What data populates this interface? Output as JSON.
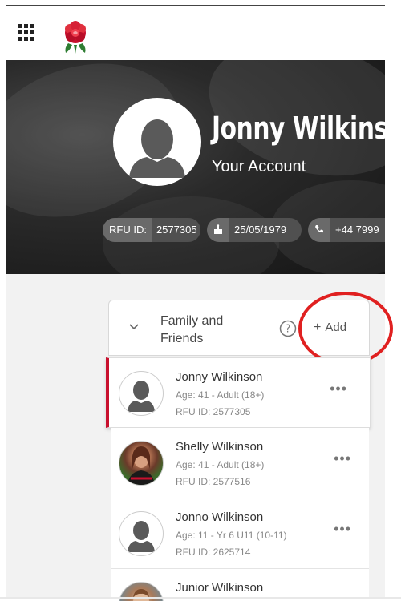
{
  "header": {
    "apps_icon": "grid-icon",
    "logo": "england-rose-logo"
  },
  "profile": {
    "name": "Jonny Wilkinson",
    "subtitle": "Your Account",
    "rfu_id_label": "RFU ID:",
    "rfu_id": "2577305",
    "dob_icon": "cake-icon",
    "dob": "25/05/1979",
    "phone_icon": "phone-icon",
    "phone": "+44 7999"
  },
  "family": {
    "title": "Family and Friends",
    "help_icon": "help-icon",
    "add_label": "Add",
    "add_symbol": "+",
    "more_symbol": "•••",
    "members": [
      {
        "name": "Jonny Wilkinson",
        "age": "Age: 41 - Adult (18+)",
        "rfu": "RFU ID: 2577305",
        "selected": true
      },
      {
        "name": "Shelly Wilkinson",
        "age": "Age: 41 - Adult (18+)",
        "rfu": "RFU ID: 2577516",
        "selected": false
      },
      {
        "name": "Jonno Wilkinson",
        "age": "Age: 11 - Yr 6 U11 (10-11)",
        "rfu": "RFU ID: 2625714",
        "selected": false
      },
      {
        "name": "Junior Wilkinson",
        "age": "",
        "rfu": "",
        "selected": false
      }
    ]
  },
  "colors": {
    "accent_red": "#c8102e",
    "annotation_red": "#e02020"
  }
}
